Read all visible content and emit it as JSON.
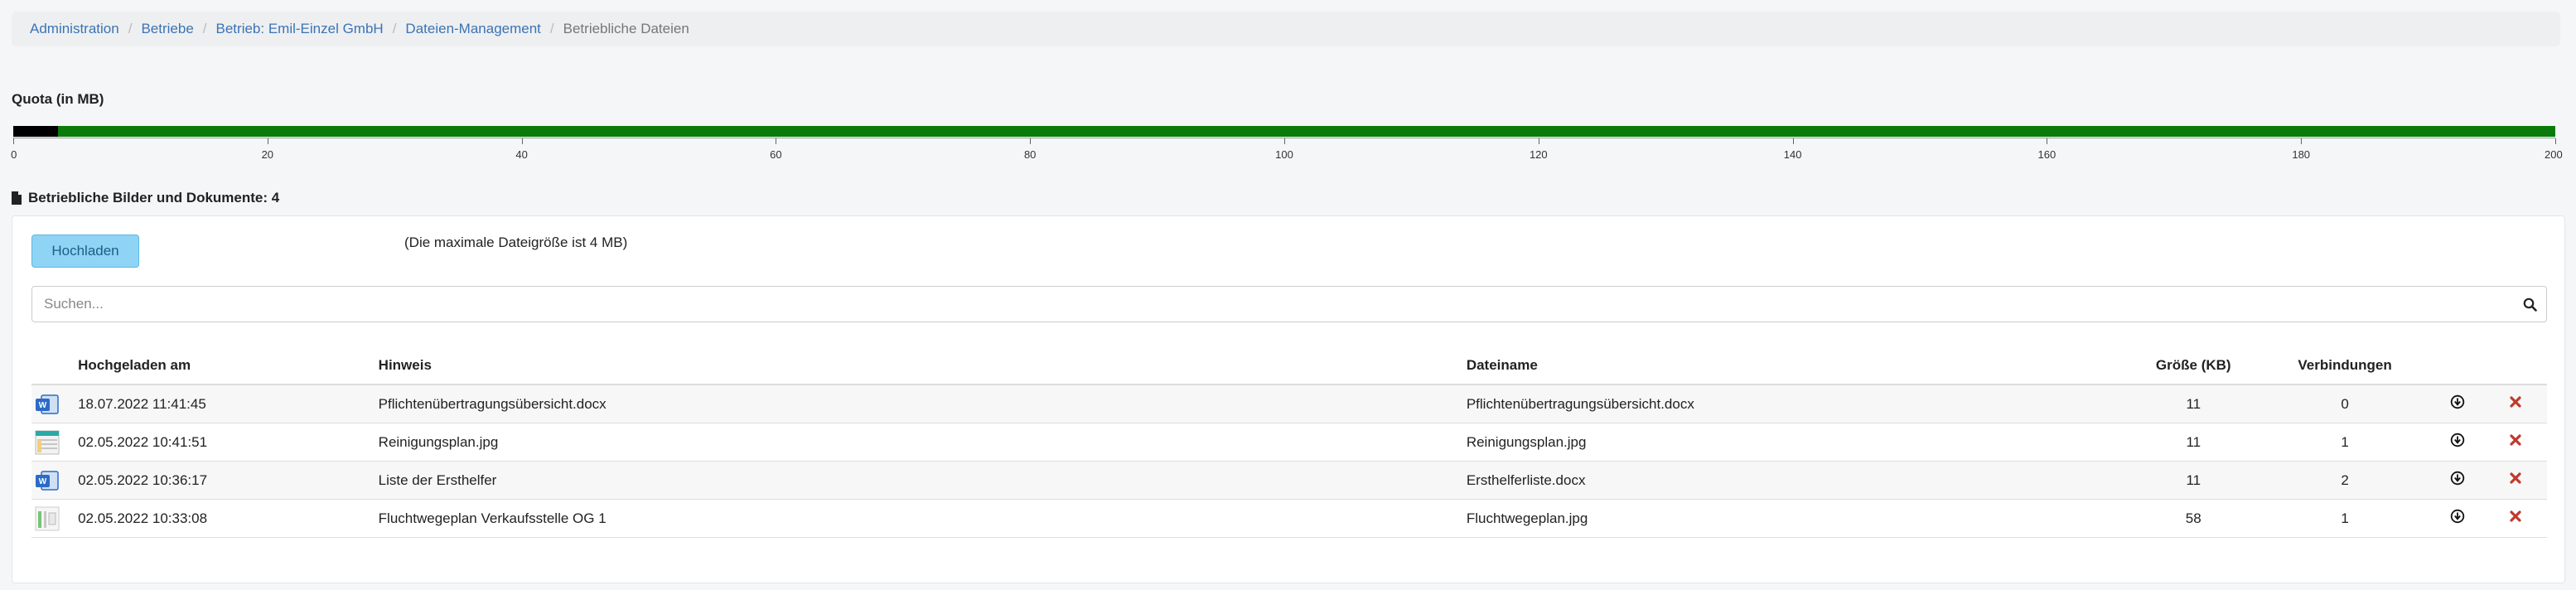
{
  "breadcrumb": [
    {
      "label": "Administration",
      "active": false
    },
    {
      "label": "Betriebe",
      "active": false
    },
    {
      "label": "Betrieb: Emil-Einzel GmbH",
      "active": false
    },
    {
      "label": "Dateien-Management",
      "active": false
    },
    {
      "label": "Betriebliche Dateien",
      "active": true
    }
  ],
  "breadcrumb_separator": "/",
  "quota": {
    "title": "Quota (in MB)",
    "used_mb": 3.5,
    "max_mb": 200,
    "ticks": [
      "0",
      "20",
      "40",
      "60",
      "80",
      "100",
      "120",
      "140",
      "160",
      "180",
      "200"
    ],
    "used_color": "#000000",
    "free_color": "#0a7a0a"
  },
  "section": {
    "title": "Betriebliche Bilder und Dokumente: 4",
    "icon": "file-icon"
  },
  "upload": {
    "button_label": "Hochladen",
    "note": "(Die maximale Dateigröße ist 4 MB)"
  },
  "search": {
    "placeholder": "Suchen...",
    "value": "",
    "icon": "search-icon"
  },
  "table": {
    "headers": {
      "uploaded": "Hochgeladen am",
      "hint": "Hinweis",
      "filename": "Dateiname",
      "size": "Größe (KB)",
      "links": "Verbindungen"
    },
    "rows": [
      {
        "type": "word",
        "uploaded": "18.07.2022 11:41:45",
        "hint": "Pflichtenübertragungsübersicht.docx",
        "filename": "Pflichtenübertragungsübersicht.docx",
        "size": "11",
        "links": "0"
      },
      {
        "type": "image-table",
        "uploaded": "02.05.2022 10:41:51",
        "hint": "Reinigungsplan.jpg",
        "filename": "Reinigungsplan.jpg",
        "size": "11",
        "links": "1"
      },
      {
        "type": "word",
        "uploaded": "02.05.2022 10:36:17",
        "hint": "Liste der Ersthelfer",
        "filename": "Ersthelferliste.docx",
        "size": "11",
        "links": "2"
      },
      {
        "type": "image-plan",
        "uploaded": "02.05.2022 10:33:08",
        "hint": "Fluchtwegeplan Verkaufsstelle OG 1",
        "filename": "Fluchtwegeplan.jpg",
        "size": "58",
        "links": "1"
      }
    ]
  },
  "icons": {
    "download": "download-icon",
    "delete": "delete-icon",
    "delete_color": "#c0392b",
    "word_color": "#2b6bc7"
  }
}
